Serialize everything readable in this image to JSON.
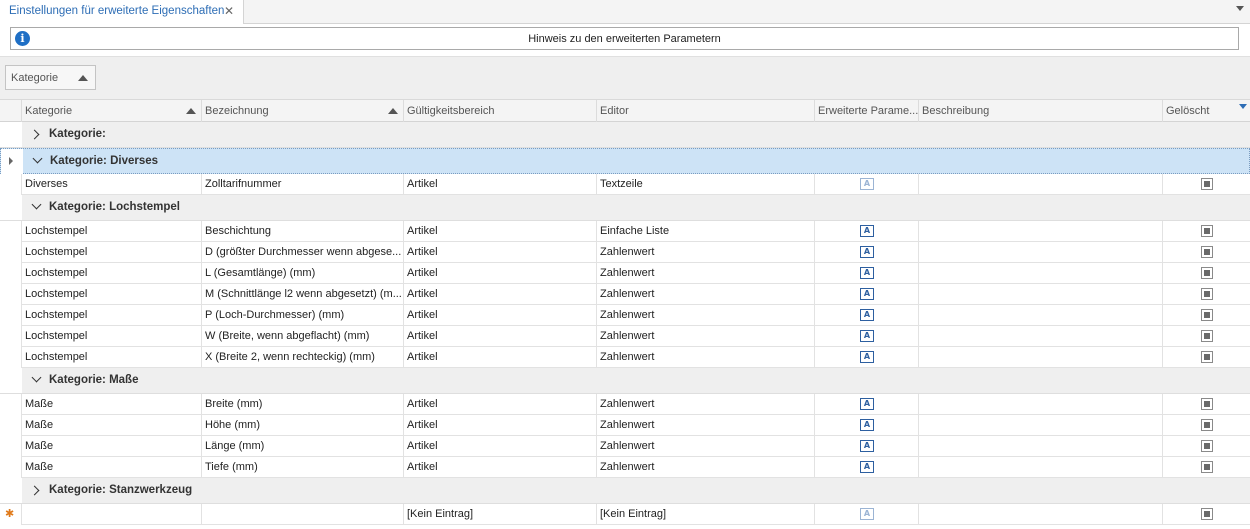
{
  "tab": {
    "title": "Einstellungen für erweiterte Eigenschaften",
    "close": "✕"
  },
  "hint": {
    "text": "Hinweis zu den erweiterten Parametern",
    "icon": "info-icon"
  },
  "group_panel": {
    "chip_label": "Kategorie"
  },
  "columns": [
    {
      "key": "kategorie",
      "label": "Kategorie",
      "sort": "asc"
    },
    {
      "key": "bezeichnung",
      "label": "Bezeichnung",
      "sort": "asc"
    },
    {
      "key": "gueltigkeit",
      "label": "Gültigkeitsbereich"
    },
    {
      "key": "editor",
      "label": "Editor"
    },
    {
      "key": "erweitert",
      "label": "Erweiterte Parame..."
    },
    {
      "key": "beschreibung",
      "label": "Beschreibung"
    },
    {
      "key": "geloescht",
      "label": "Gelöscht"
    }
  ],
  "groups": [
    {
      "label": "Kategorie:",
      "expanded": false,
      "selected": false,
      "rows": []
    },
    {
      "label": "Kategorie: Diverses",
      "expanded": true,
      "selected": true,
      "rows": [
        {
          "kategorie": "Diverses",
          "bezeichnung": "Zolltarifnummer",
          "gueltigkeit": "Artikel",
          "editor": "Textzeile",
          "erweitert_active": false
        }
      ]
    },
    {
      "label": "Kategorie: Lochstempel",
      "expanded": true,
      "selected": false,
      "rows": [
        {
          "kategorie": "Lochstempel",
          "bezeichnung": "Beschichtung",
          "gueltigkeit": "Artikel",
          "editor": "Einfache Liste",
          "erweitert_active": true
        },
        {
          "kategorie": "Lochstempel",
          "bezeichnung": "D (größter Durchmesser wenn abgese...",
          "gueltigkeit": "Artikel",
          "editor": "Zahlenwert",
          "erweitert_active": true
        },
        {
          "kategorie": "Lochstempel",
          "bezeichnung": "L (Gesamtlänge) (mm)",
          "gueltigkeit": "Artikel",
          "editor": "Zahlenwert",
          "erweitert_active": true
        },
        {
          "kategorie": "Lochstempel",
          "bezeichnung": "M (Schnittlänge l2 wenn abgesetzt) (m...",
          "gueltigkeit": "Artikel",
          "editor": "Zahlenwert",
          "erweitert_active": true
        },
        {
          "kategorie": "Lochstempel",
          "bezeichnung": "P (Loch-Durchmesser) (mm)",
          "gueltigkeit": "Artikel",
          "editor": "Zahlenwert",
          "erweitert_active": true
        },
        {
          "kategorie": "Lochstempel",
          "bezeichnung": "W (Breite, wenn abgeflacht) (mm)",
          "gueltigkeit": "Artikel",
          "editor": "Zahlenwert",
          "erweitert_active": true
        },
        {
          "kategorie": "Lochstempel",
          "bezeichnung": "X (Breite 2, wenn rechteckig) (mm)",
          "gueltigkeit": "Artikel",
          "editor": "Zahlenwert",
          "erweitert_active": true
        }
      ]
    },
    {
      "label": "Kategorie: Maße",
      "expanded": true,
      "selected": false,
      "rows": [
        {
          "kategorie": "Maße",
          "bezeichnung": "Breite (mm)",
          "gueltigkeit": "Artikel",
          "editor": "Zahlenwert",
          "erweitert_active": true
        },
        {
          "kategorie": "Maße",
          "bezeichnung": "Höhe (mm)",
          "gueltigkeit": "Artikel",
          "editor": "Zahlenwert",
          "erweitert_active": true
        },
        {
          "kategorie": "Maße",
          "bezeichnung": "Länge (mm)",
          "gueltigkeit": "Artikel",
          "editor": "Zahlenwert",
          "erweitert_active": true
        },
        {
          "kategorie": "Maße",
          "bezeichnung": "Tiefe (mm)",
          "gueltigkeit": "Artikel",
          "editor": "Zahlenwert",
          "erweitert_active": true
        }
      ]
    },
    {
      "label": "Kategorie: Stanzwerkzeug",
      "expanded": false,
      "selected": false,
      "rows": []
    }
  ],
  "new_row": {
    "marker": "✱",
    "kategorie": "",
    "bezeichnung": "",
    "gueltigkeit": "[Kein Eintrag]",
    "editor": "[Kein Eintrag]",
    "erweitert_active": false
  },
  "editor_icon_glyph": "A",
  "colors": {
    "accent": "#2d6db5",
    "selected_group": "#cde3f6",
    "group_bg": "#efefef",
    "new_row_marker": "#e07a1a"
  }
}
